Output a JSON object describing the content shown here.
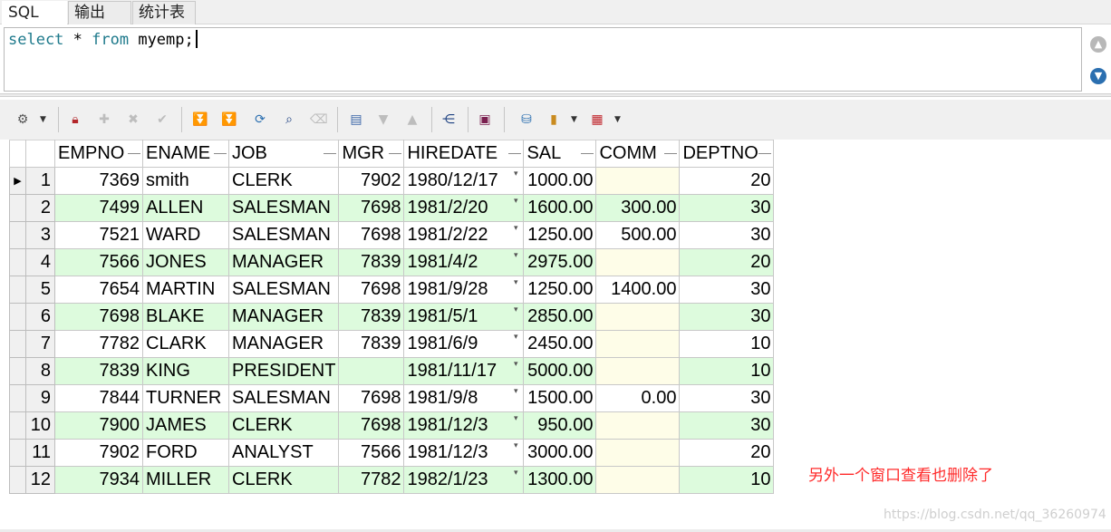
{
  "tabs": [
    {
      "label": "SQL"
    },
    {
      "label": "输出"
    },
    {
      "label": "统计表"
    }
  ],
  "editor": {
    "kw_select": "select",
    "star": " * ",
    "kw_from": "from",
    "rest": " myemp;"
  },
  "toolbar_icons": [
    "grid-settings-icon",
    "lock-icon",
    "add-record-icon",
    "delete-record-icon",
    "post-icon",
    "first-record-icon",
    "last-record-icon",
    "refresh-icon",
    "find-icon",
    "clear-icon",
    "filter-icon",
    "sort-desc-icon",
    "sort-asc-icon",
    "export-tree-icon",
    "save-icon",
    "query-properties-icon",
    "chart-icon",
    "table-view-icon"
  ],
  "grid": {
    "columns": [
      "EMPNO",
      "ENAME",
      "JOB",
      "MGR",
      "HIREDATE",
      "SAL",
      "COMM",
      "DEPTNO"
    ],
    "rows": [
      {
        "n": "1",
        "empno": "7369",
        "ename": "smith",
        "job": "CLERK",
        "mgr": "7902",
        "hiredate": "1980/12/17",
        "sal": "1000.00",
        "comm": "",
        "deptno": "20"
      },
      {
        "n": "2",
        "empno": "7499",
        "ename": "ALLEN",
        "job": "SALESMAN",
        "mgr": "7698",
        "hiredate": "1981/2/20",
        "sal": "1600.00",
        "comm": "300.00",
        "deptno": "30"
      },
      {
        "n": "3",
        "empno": "7521",
        "ename": "WARD",
        "job": "SALESMAN",
        "mgr": "7698",
        "hiredate": "1981/2/22",
        "sal": "1250.00",
        "comm": "500.00",
        "deptno": "30"
      },
      {
        "n": "4",
        "empno": "7566",
        "ename": "JONES",
        "job": "MANAGER",
        "mgr": "7839",
        "hiredate": "1981/4/2",
        "sal": "2975.00",
        "comm": "",
        "deptno": "20"
      },
      {
        "n": "5",
        "empno": "7654",
        "ename": "MARTIN",
        "job": "SALESMAN",
        "mgr": "7698",
        "hiredate": "1981/9/28",
        "sal": "1250.00",
        "comm": "1400.00",
        "deptno": "30"
      },
      {
        "n": "6",
        "empno": "7698",
        "ename": "BLAKE",
        "job": "MANAGER",
        "mgr": "7839",
        "hiredate": "1981/5/1",
        "sal": "2850.00",
        "comm": "",
        "deptno": "30"
      },
      {
        "n": "7",
        "empno": "7782",
        "ename": "CLARK",
        "job": "MANAGER",
        "mgr": "7839",
        "hiredate": "1981/6/9",
        "sal": "2450.00",
        "comm": "",
        "deptno": "10"
      },
      {
        "n": "8",
        "empno": "7839",
        "ename": "KING",
        "job": "PRESIDENT",
        "mgr": "",
        "hiredate": "1981/11/17",
        "sal": "5000.00",
        "comm": "",
        "deptno": "10"
      },
      {
        "n": "9",
        "empno": "7844",
        "ename": "TURNER",
        "job": "SALESMAN",
        "mgr": "7698",
        "hiredate": "1981/9/8",
        "sal": "1500.00",
        "comm": "0.00",
        "deptno": "30"
      },
      {
        "n": "10",
        "empno": "7900",
        "ename": "JAMES",
        "job": "CLERK",
        "mgr": "7698",
        "hiredate": "1981/12/3",
        "sal": "950.00",
        "comm": "",
        "deptno": "30"
      },
      {
        "n": "11",
        "empno": "7902",
        "ename": "FORD",
        "job": "ANALYST",
        "mgr": "7566",
        "hiredate": "1981/12/3",
        "sal": "3000.00",
        "comm": "",
        "deptno": "20"
      },
      {
        "n": "12",
        "empno": "7934",
        "ename": "MILLER",
        "job": "CLERK",
        "mgr": "7782",
        "hiredate": "1982/1/23",
        "sal": "1300.00",
        "comm": "",
        "deptno": "10"
      }
    ]
  },
  "annotation": "另外一个窗口查看也删除了",
  "watermark": "https://blog.csdn.net/qq_36260974",
  "colors": {
    "even_row": "#ddfbdd",
    "null_cell": "#fefde8",
    "annotation": "#ff2a2a"
  }
}
